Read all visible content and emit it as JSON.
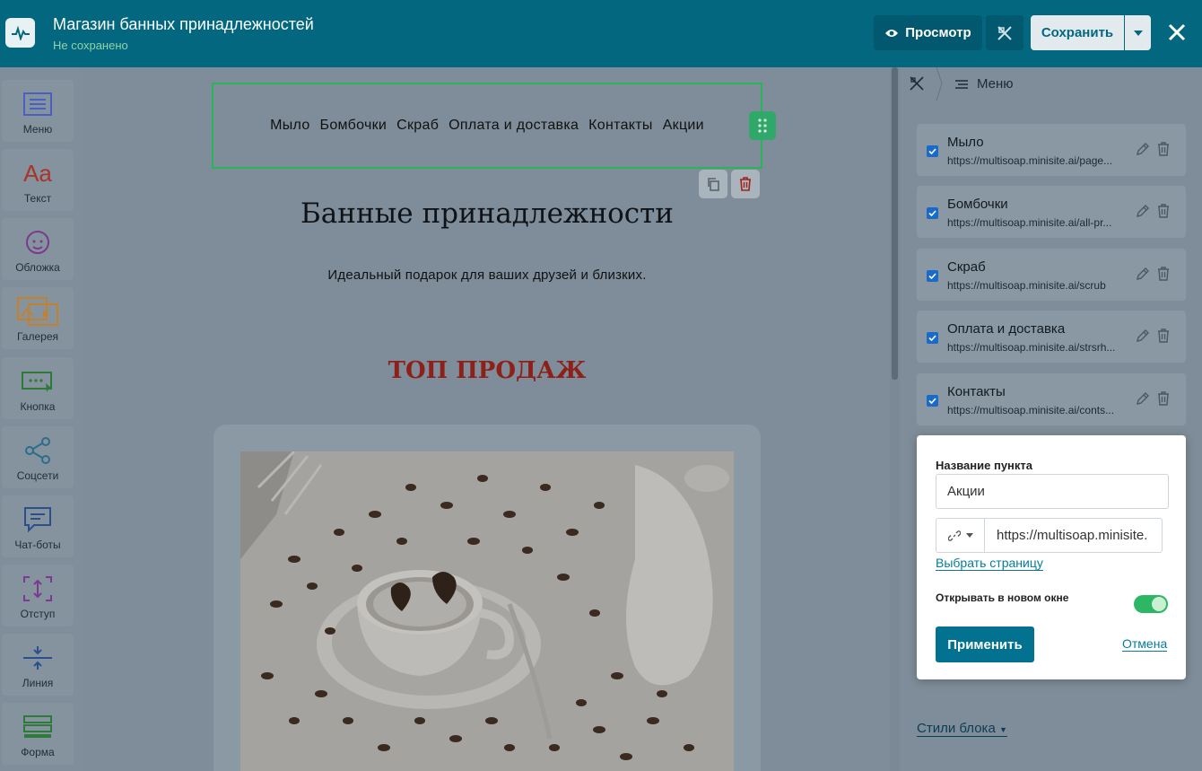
{
  "header": {
    "title": "Магазин банных принадлежностей",
    "status": "Не сохранено",
    "preview_label": "Просмотр",
    "save_label": "Сохранить"
  },
  "toolbar": {
    "items": [
      {
        "label": "Меню",
        "icon": "menu-icon"
      },
      {
        "label": "Текст",
        "icon": "text-icon"
      },
      {
        "label": "Обложка",
        "icon": "cover-icon"
      },
      {
        "label": "Галерея",
        "icon": "gallery-icon"
      },
      {
        "label": "Кнопка",
        "icon": "button-icon"
      },
      {
        "label": "Соцсети",
        "icon": "share-icon"
      },
      {
        "label": "Чат-боты",
        "icon": "chat-icon"
      },
      {
        "label": "Отступ",
        "icon": "spacing-icon"
      },
      {
        "label": "Линия",
        "icon": "line-icon"
      },
      {
        "label": "Форма",
        "icon": "form-icon"
      }
    ]
  },
  "page": {
    "nav": [
      "Мыло",
      "Бомбочки",
      "Скраб",
      "Оплата и доставка",
      "Контакты",
      "Акции"
    ],
    "heading": "Банные принадлежности",
    "subheading": "Идеальный подарок для ваших друзей и близких.",
    "section_title": "ТОП ПРОДАЖ"
  },
  "panel": {
    "breadcrumb": "Меню",
    "items": [
      {
        "name": "Мыло",
        "url": "https://multisoap.minisite.ai/page..."
      },
      {
        "name": "Бомбочки",
        "url": "https://multisoap.minisite.ai/all-pr..."
      },
      {
        "name": "Скраб",
        "url": "https://multisoap.minisite.ai/scrub"
      },
      {
        "name": "Оплата и доставка",
        "url": "https://multisoap.minisite.ai/strsrh..."
      },
      {
        "name": "Контакты",
        "url": "https://multisoap.minisite.ai/conts..."
      }
    ],
    "block_styles_label": "Стили блока"
  },
  "popup": {
    "name_label": "Название пункта",
    "name_value": "Акции",
    "url_value": "https://multisoap.minisite.",
    "choose_page_label": "Выбрать страницу",
    "new_window_label": "Открывать в новом окне",
    "new_window_on": true,
    "apply_label": "Применить",
    "cancel_label": "Отмена"
  },
  "colors": {
    "topbar": "#036780",
    "accent_green": "#2db663",
    "section_title": "#8d211a"
  }
}
